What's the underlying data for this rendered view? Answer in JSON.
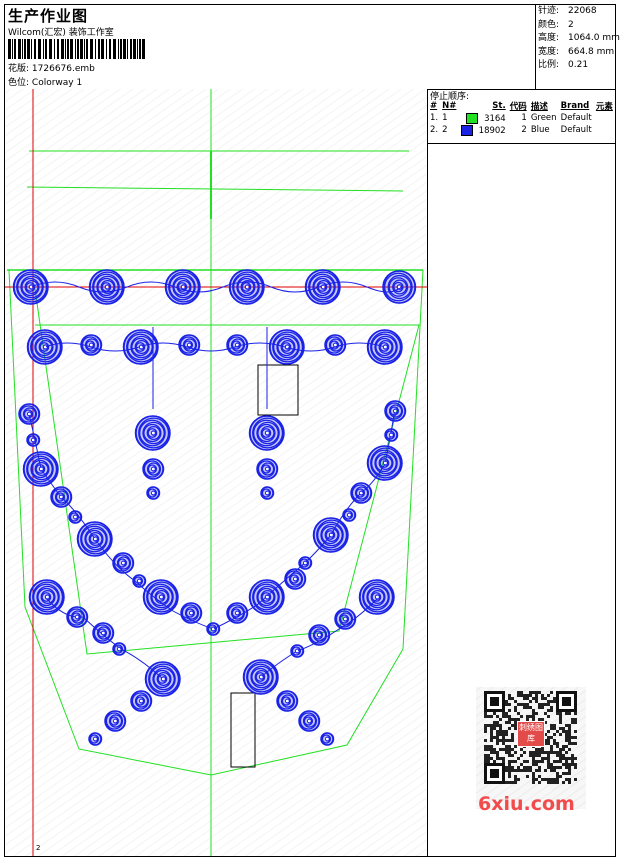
{
  "header": {
    "title": "生产作业图",
    "designer": "Wilcom(汇宏) 装饰工作室",
    "design_label": "花版:",
    "design_file": "1726676.emb",
    "colorway_label": "色位:",
    "colorway": "Colorway 1"
  },
  "stats": [
    {
      "label": "针迹:",
      "value": "22068"
    },
    {
      "label": "颜色:",
      "value": "2"
    },
    {
      "label": "高度:",
      "value": "1064.0 mm"
    },
    {
      "label": "宽度:",
      "value": "664.8 mm"
    },
    {
      "label": "比例:",
      "value": "0.21"
    }
  ],
  "stop_sequence": {
    "title": "停止顺序:",
    "columns": [
      "#",
      "N#",
      "St.",
      "代码",
      "描述",
      "Brand",
      "元素"
    ],
    "rows": [
      {
        "num": "1.",
        "n": "1",
        "color": "#22e022",
        "stitches": "3164",
        "code": "1",
        "desc": "Green",
        "brand": "Default"
      },
      {
        "num": "2.",
        "n": "2",
        "color": "#1a22e6",
        "stitches": "18902",
        "code": "2",
        "desc": "Blue",
        "brand": "Default"
      }
    ]
  },
  "canvas": {
    "bottom_marker": "2",
    "outline_color": "#22e022",
    "stitch_color": "#1a22e6",
    "guide_color": "#e00000"
  },
  "watermark": {
    "text": "6xiu.com",
    "qr_center_text": "刺绣图库"
  }
}
